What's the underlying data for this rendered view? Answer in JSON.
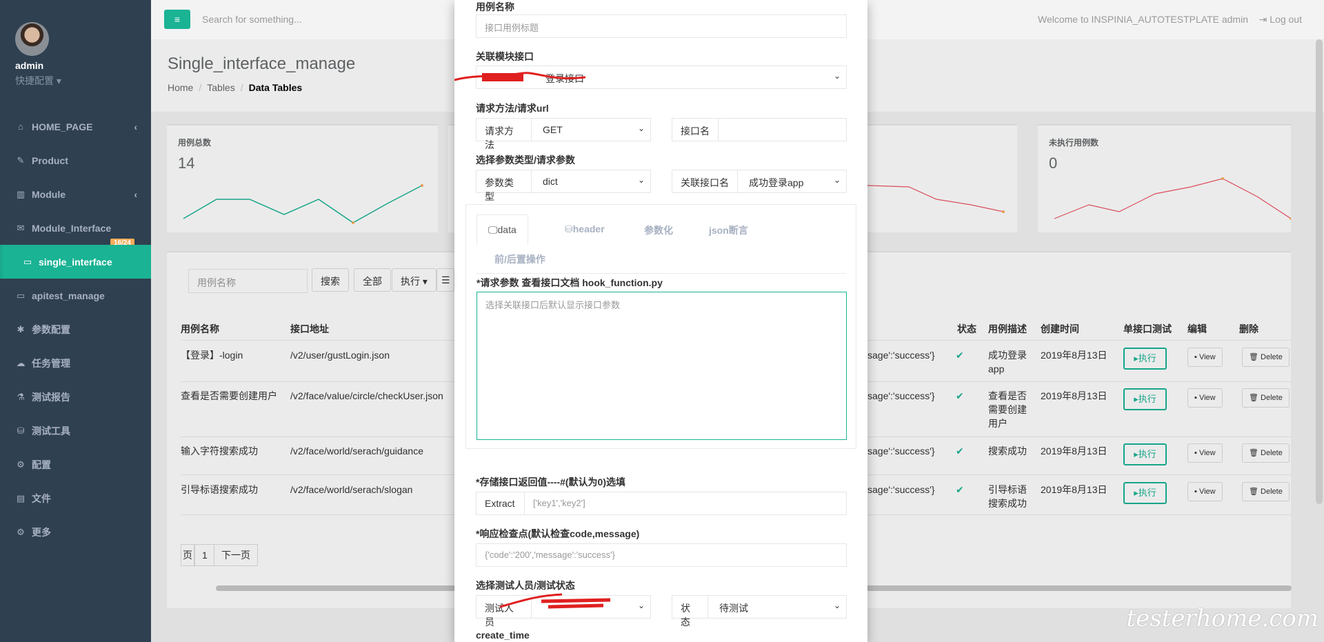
{
  "profile": {
    "name": "admin",
    "sub": "快捷配置 ▾"
  },
  "nav": [
    {
      "icon": "⌂",
      "label": "HOME_PAGE",
      "arrow": "‹"
    },
    {
      "icon": "✎",
      "label": "Product",
      "arrow": ""
    },
    {
      "icon": "▥",
      "label": "Module",
      "arrow": "‹"
    },
    {
      "icon": "✉",
      "label": "Module_Interface",
      "arrow": "",
      "badge": "16/24"
    },
    {
      "icon": "▭",
      "label": "single_interface",
      "arrow": "",
      "active": true
    },
    {
      "icon": "▭",
      "label": "apitest_manage",
      "arrow": ""
    },
    {
      "icon": "✱",
      "label": "参数配置",
      "arrow": ""
    },
    {
      "icon": "☁",
      "label": "任务管理",
      "arrow": ""
    },
    {
      "icon": "⚗",
      "label": "测试报告",
      "arrow": ""
    },
    {
      "icon": "⛁",
      "label": "测试工具",
      "arrow": ""
    },
    {
      "icon": "⚙",
      "label": "配置",
      "arrow": ""
    },
    {
      "icon": "▤",
      "label": "文件",
      "arrow": ""
    },
    {
      "icon": "⚙",
      "label": "更多",
      "arrow": ""
    }
  ],
  "topbar": {
    "menu_icon": "≡",
    "search_placeholder": "Search for something...",
    "welcome": "Welcome to INSPINIA_AUTOTESTPLATE admin",
    "logout": "⇥ Log out"
  },
  "heading": {
    "title": "Single_interface_manage",
    "crumbs": [
      "Home",
      "Tables",
      "Data Tables"
    ]
  },
  "stats": [
    {
      "title": "用例总数",
      "value": "14"
    },
    {
      "title": "未执行用例数",
      "value": "0"
    }
  ],
  "filter": {
    "placeholder": "用例名称",
    "search": "搜索",
    "all": "全部",
    "exec": "执行 ▾",
    "more": "☰"
  },
  "table": {
    "headers": [
      "用例名称",
      "接口地址",
      "状态",
      "用例描述",
      "创建时间",
      "单接口测试",
      "编辑",
      "删除"
    ],
    "rows": [
      {
        "name": "【登录】-login",
        "url": "/v2/user/gustLogin.json",
        "check": "sage':'success'}",
        "desc": [
          "成功登录",
          "app"
        ],
        "time": "2019年8月13日"
      },
      {
        "name": "查看是否需要创建用户",
        "url": "/v2/face/value/circle/checkUser.json",
        "check": "sage':'success'}",
        "desc": [
          "查看是否",
          "需要创建",
          "用户"
        ],
        "time": "2019年8月13日"
      },
      {
        "name": "输入字符搜索成功",
        "url": "/v2/face/world/serach/guidance",
        "check": "sage':'success'}",
        "desc": [
          "搜索成功"
        ],
        "time": "2019年8月13日"
      },
      {
        "name": "引导标语搜索成功",
        "url": "/v2/face/world/serach/slogan",
        "check": "sage':'success'}",
        "desc": [
          "引导标语",
          "搜索成功"
        ],
        "time": "2019年8月13日"
      }
    ],
    "exec_label": "▸执行",
    "view_label": "▪ View",
    "delete_label": "🗑 Delete",
    "status_icon": "✔"
  },
  "pager": {
    "prev": "页",
    "page": "1",
    "next": "下一页"
  },
  "modal": {
    "case_name_label": "用例名称",
    "case_name_placeholder": "接口用例标题",
    "module_label": "关联模块接口",
    "module_value": "登录接口",
    "method_label": "请求方法/请求url",
    "method_addon": "请求方法",
    "method_value": "GET",
    "iface_addon": "接口名",
    "param_label": "选择参数类型/请求参数",
    "param_addon": "参数类型",
    "param_value": "dict",
    "rel_addon": "关联接口名",
    "rel_value": "成功登录app",
    "tabs": [
      "🖵data",
      "⛁header",
      "参数化",
      "json断言",
      "前/后置操作"
    ],
    "req_label": "*请求参数 查看接口文档 hook_function.py",
    "req_placeholder": "选择关联接口后默认显示接口参数",
    "store_label": "*存储接口返回值----#(默认为0)选填",
    "extract_addon": "Extract",
    "extract_placeholder": "['key1','key2']",
    "resp_label": "*响应检查点(默认检查code,message)",
    "resp_placeholder": "{'code':'200','message':'success'}",
    "tester_label": "选择测试人员/测试状态",
    "tester_addon": "测试人员",
    "status_addon": "状态",
    "status_value": "待测试",
    "create_time_label": "create_time"
  },
  "watermark": "testerhome.com"
}
